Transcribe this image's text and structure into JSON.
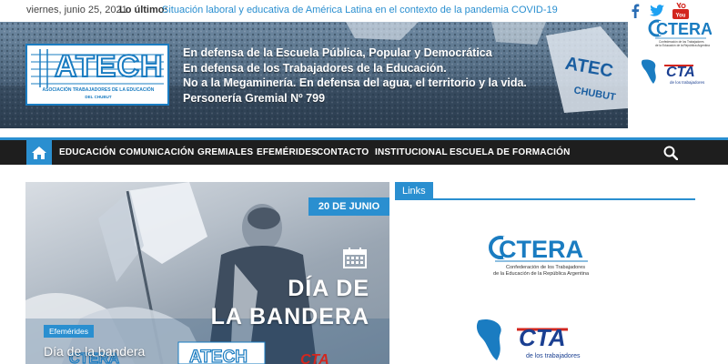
{
  "topbar": {
    "date": "viernes, junio 25, 2021",
    "latest_label": "Lo último:",
    "latest_link": "Situación laboral y educativa de América Latina en el contexto de la pandemia COVID-19",
    "social": [
      "facebook-icon",
      "twitter-icon",
      "youtube-icon"
    ]
  },
  "header": {
    "logo_text": "ATECH",
    "logo_sub1": "ASOCIACIÓN TRABAJADORES DE LA EDUCACIÓN",
    "logo_sub2": "DEL CHUBUT",
    "motto": [
      "En defensa de la Escuela Pública, Popular y Democrática",
      "En defensa de los Trabajadores de la Educación.",
      "No a la Megaminería. En defensa del agua, el territorio y la vida.",
      "Personería Gremial Nº 799"
    ],
    "ctera_text": "CTERA",
    "ctera_sub": "Confederación de los Trabajadores de la Educación de la República Argentina",
    "cta_text": "CTA",
    "cta_sub": "de los trabajadores"
  },
  "nav": {
    "items": [
      "EDUCACIÓN",
      "COMUNICACIÓN",
      "GREMIALES",
      "EFEMÉRIDES",
      "CONTACTO",
      "INSTITUCIONAL",
      "ESCUELA DE FORMACIÓN"
    ]
  },
  "featured": {
    "date_ribbon": "20 DE JUNIO",
    "title_line1": "DÍA DE",
    "title_line2": "LA BANDERA",
    "category": "Efemérides",
    "caption": "Día de la bandera",
    "footer_logos": [
      "CTERA",
      "ATECH",
      "CTA"
    ]
  },
  "sidebar": {
    "links_title": "Links",
    "ctera_text": "CTERA",
    "ctera_sub1": "Confederación de los Trabajadores",
    "ctera_sub2": "de la Educación de la República Argentina",
    "cta_text": "CTA",
    "cta_sub": "de los trabajadores"
  },
  "colors": {
    "accent": "#2a8fd0",
    "nav_bg": "#1e1e1e",
    "logo_blue": "#1a7cc1"
  }
}
